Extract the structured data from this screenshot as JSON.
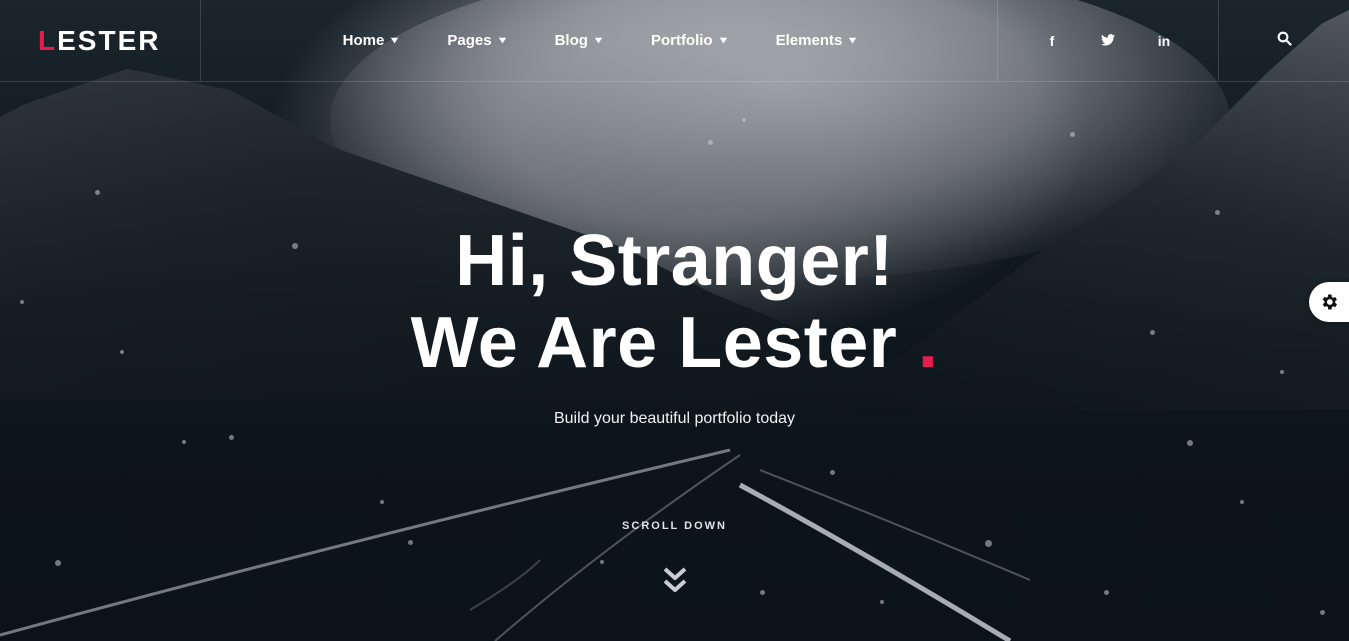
{
  "brand": {
    "logo_first": "L",
    "logo_rest": "ESTER"
  },
  "nav": {
    "items": [
      {
        "label": "Home"
      },
      {
        "label": "Pages"
      },
      {
        "label": "Blog"
      },
      {
        "label": "Portfolio"
      },
      {
        "label": "Elements"
      }
    ]
  },
  "social": {
    "facebook": "f",
    "twitter": "twitter-icon",
    "linkedin": "in"
  },
  "hero": {
    "line1": "Hi, Stranger!",
    "line2": "We Are Lester",
    "accent_dot": ".",
    "subtitle": "Build your beautiful portfolio today",
    "scroll_label": "SCROLL DOWN"
  },
  "colors": {
    "accent": "#e51c4e",
    "background": "#0f1a20",
    "text": "#ffffff"
  },
  "icons": [
    "chevron-down-icon",
    "facebook-icon",
    "twitter-icon",
    "linkedin-icon",
    "search-icon",
    "double-chevron-down-icon",
    "gear-icon"
  ]
}
